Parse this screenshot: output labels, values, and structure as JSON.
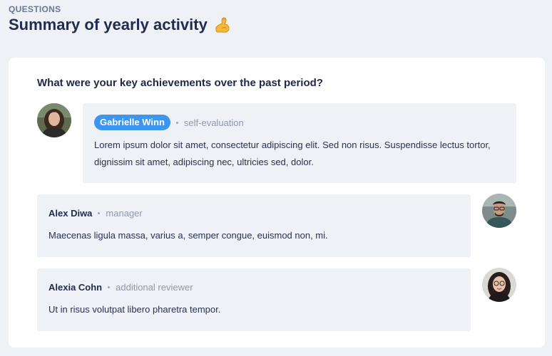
{
  "header": {
    "section_label": "QUESTIONS",
    "title": "Summary of yearly activity",
    "title_emoji": "flexed-biceps-icon"
  },
  "question": {
    "text": "What were your key achievements over the past period?"
  },
  "responses": [
    {
      "name": "Gabrielle Winn",
      "role": "self-evaluation",
      "text": "Lorem ipsum dolor sit amet, consectetur adipiscing elit. Sed non risus. Suspendisse lectus tortor, dignissim sit amet, adipiscing nec, ultricies sed, dolor.",
      "highlight_color": "#3d95ee"
    },
    {
      "name": "Alex Diwa",
      "role": "manager",
      "text": "Maecenas ligula massa, varius a, semper congue, euismod non, mi."
    },
    {
      "name": "Alexia Cohn",
      "role": "additional reviewer",
      "text": "Ut in risus volutpat libero pharetra tempor."
    }
  ],
  "colors": {
    "page_bg": "#eef1f5",
    "card_bg": "#ffffff",
    "bubble_bg": "#eef1f6",
    "accent": "#3d95ee"
  }
}
